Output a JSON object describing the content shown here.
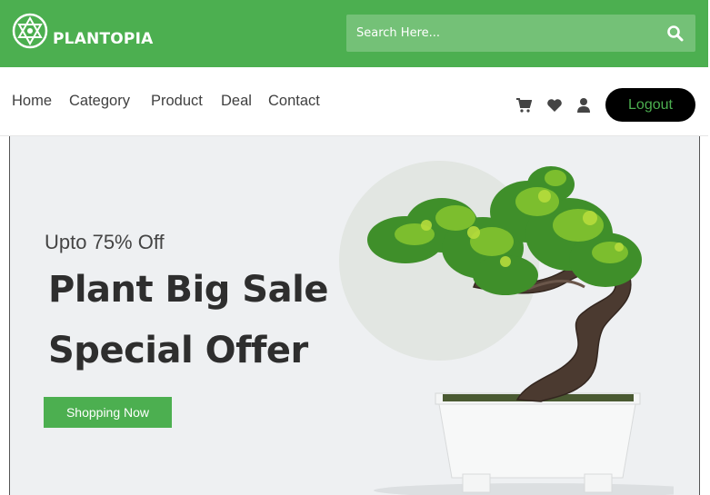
{
  "brand": {
    "name": "PLANTOPIA",
    "logo_icon": "plant-logo-icon"
  },
  "search": {
    "placeholder": "Search Here...",
    "value": "",
    "icon": "search-icon"
  },
  "nav": {
    "links": [
      "Home",
      "Category",
      "Product",
      "Deal",
      "Contact"
    ],
    "icons": [
      "cart-icon",
      "heart-icon",
      "user-icon"
    ],
    "logout_label": "Logout"
  },
  "hero": {
    "eyebrow": "Upto 75% Off",
    "title_line1": "Plant Big Sale",
    "title_line2": "Special Offer",
    "cta_label": "Shopping Now",
    "image": "bonsai-tree-image"
  },
  "colors": {
    "accent": "#4caf50",
    "search_bg": "#74c177",
    "logout_bg": "#000000",
    "hero_bg": "#eef0f2",
    "text_dark": "#2e2e2e"
  }
}
